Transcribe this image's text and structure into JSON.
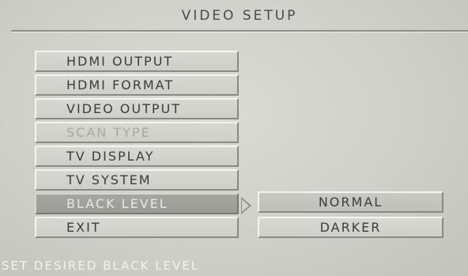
{
  "title": "VIDEO SETUP",
  "menu": {
    "items": [
      {
        "label": "HDMI OUTPUT"
      },
      {
        "label": "HDMI FORMAT"
      },
      {
        "label": "VIDEO OUTPUT"
      },
      {
        "label": "SCAN TYPE"
      },
      {
        "label": "TV DISPLAY"
      },
      {
        "label": "TV SYSTEM"
      },
      {
        "label": "BLACK LEVEL"
      },
      {
        "label": "EXIT"
      }
    ]
  },
  "submenu": {
    "options": [
      {
        "label": "NORMAL"
      },
      {
        "label": "DARKER"
      }
    ]
  },
  "status": "SET DESIRED BLACK LEVEL",
  "colors": {
    "background": "#d2d2cc",
    "selected": "#a3a39e",
    "text": "#3c3c3c",
    "disabled_text": "#a8a8a3"
  }
}
